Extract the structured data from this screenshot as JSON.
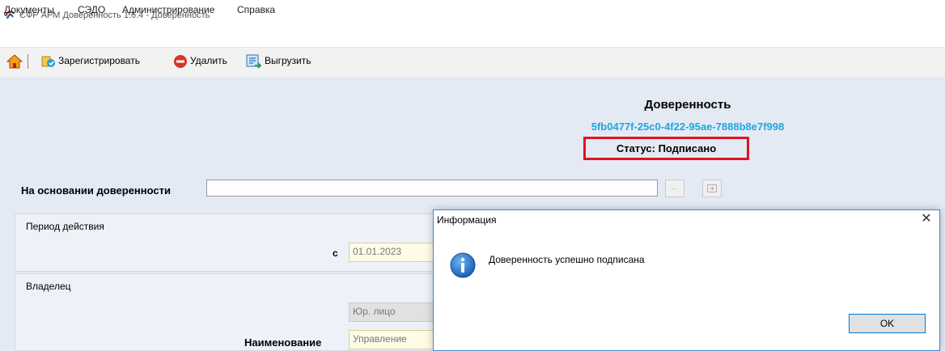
{
  "window": {
    "title": "СФР АРМ Доверенность 1.6.4 - Доверенность"
  },
  "menu": {
    "items": [
      "Документы",
      "СЭДО",
      "Администрирование",
      "Справка"
    ]
  },
  "toolbar": {
    "register_label": "Зарегистрировать",
    "delete_label": "Удалить",
    "export_label": "Выгрузить"
  },
  "document": {
    "title": "Доверенность",
    "guid": "5fb0477f-25c0-4f22-95ae-7888b8e7f998",
    "status": "Статус: Подписано",
    "highlight_color": "#e0141e"
  },
  "basis": {
    "label": "На основании доверенности",
    "value": "",
    "browse_label": "..."
  },
  "validity": {
    "header": "Период действия",
    "from_label": "с",
    "from_value": "01.01.2023"
  },
  "owner": {
    "header": "Владелец",
    "type_value": "Юр. лицо",
    "name_label": "Наименование",
    "name_value": "Управление"
  },
  "dialog": {
    "title": "Информация",
    "message": "Доверенность успешно подписана",
    "ok_label": "OK",
    "icon": "info-icon",
    "border_color": "#3f8ad8"
  }
}
